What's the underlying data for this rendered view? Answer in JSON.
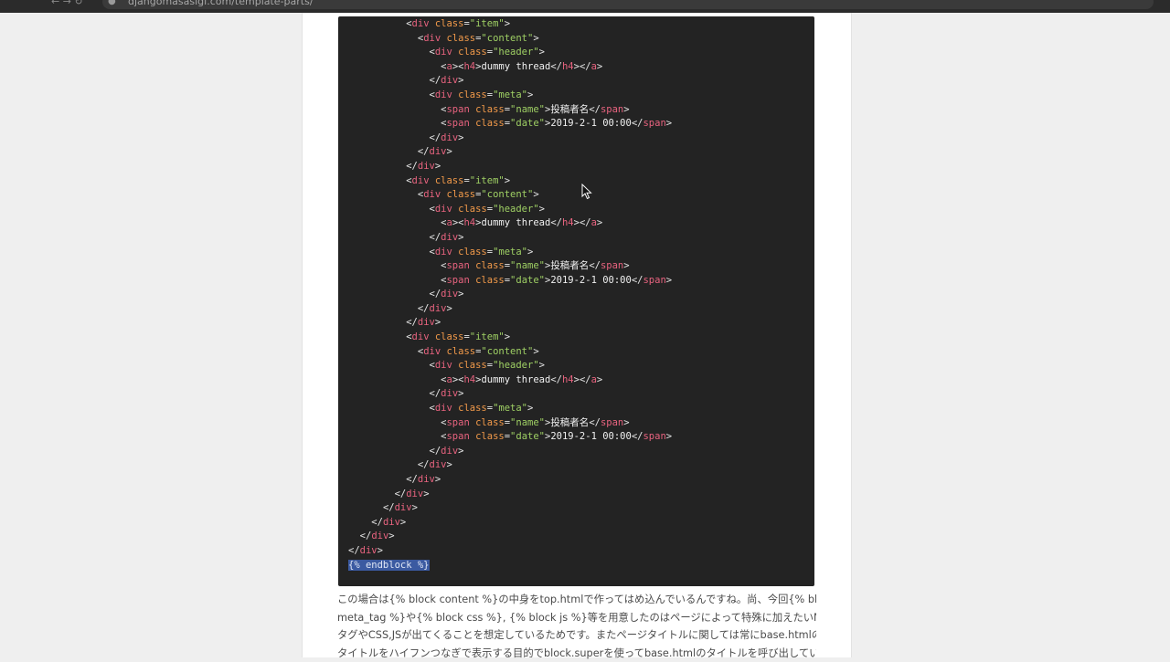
{
  "browser": {
    "url": "djangomasasigi.com/template-parts/",
    "nav_glyphs": "←  →  ↻"
  },
  "code": {
    "highlighted_text": "{% endblock %}",
    "lines": [
      {
        "indent": 5,
        "tokens": [
          [
            "p",
            "<"
          ],
          [
            "t",
            "div"
          ],
          [
            "p",
            " "
          ],
          [
            "a",
            "class"
          ],
          [
            "p",
            "="
          ],
          [
            "s",
            "\"item\""
          ],
          [
            "p",
            ">"
          ]
        ]
      },
      {
        "indent": 6,
        "tokens": [
          [
            "p",
            "<"
          ],
          [
            "t",
            "div"
          ],
          [
            "p",
            " "
          ],
          [
            "a",
            "class"
          ],
          [
            "p",
            "="
          ],
          [
            "s",
            "\"content\""
          ],
          [
            "p",
            ">"
          ]
        ]
      },
      {
        "indent": 7,
        "tokens": [
          [
            "p",
            "<"
          ],
          [
            "t",
            "div"
          ],
          [
            "p",
            " "
          ],
          [
            "a",
            "class"
          ],
          [
            "p",
            "="
          ],
          [
            "s",
            "\"header\""
          ],
          [
            "p",
            ">"
          ]
        ]
      },
      {
        "indent": 8,
        "tokens": [
          [
            "p",
            "<"
          ],
          [
            "t",
            "a"
          ],
          [
            "p",
            "><"
          ],
          [
            "t",
            "h4"
          ],
          [
            "p",
            ">"
          ],
          [
            "x",
            "dummy thread"
          ],
          [
            "p",
            "</"
          ],
          [
            "t",
            "h4"
          ],
          [
            "p",
            "></"
          ],
          [
            "t",
            "a"
          ],
          [
            "p",
            ">"
          ]
        ]
      },
      {
        "indent": 7,
        "tokens": [
          [
            "p",
            "</"
          ],
          [
            "t",
            "div"
          ],
          [
            "p",
            ">"
          ]
        ]
      },
      {
        "indent": 7,
        "tokens": [
          [
            "p",
            "<"
          ],
          [
            "t",
            "div"
          ],
          [
            "p",
            " "
          ],
          [
            "a",
            "class"
          ],
          [
            "p",
            "="
          ],
          [
            "s",
            "\"meta\""
          ],
          [
            "p",
            ">"
          ]
        ]
      },
      {
        "indent": 8,
        "tokens": [
          [
            "p",
            "<"
          ],
          [
            "t",
            "span"
          ],
          [
            "p",
            " "
          ],
          [
            "a",
            "class"
          ],
          [
            "p",
            "="
          ],
          [
            "s",
            "\"name\""
          ],
          [
            "p",
            ">"
          ],
          [
            "x",
            "投稿者名"
          ],
          [
            "p",
            "</"
          ],
          [
            "t",
            "span"
          ],
          [
            "p",
            ">"
          ]
        ]
      },
      {
        "indent": 8,
        "tokens": [
          [
            "p",
            "<"
          ],
          [
            "t",
            "span"
          ],
          [
            "p",
            " "
          ],
          [
            "a",
            "class"
          ],
          [
            "p",
            "="
          ],
          [
            "s",
            "\"date\""
          ],
          [
            "p",
            ">"
          ],
          [
            "x",
            "2019-2-1 00:00"
          ],
          [
            "p",
            "</"
          ],
          [
            "t",
            "span"
          ],
          [
            "p",
            ">"
          ]
        ]
      },
      {
        "indent": 7,
        "tokens": [
          [
            "p",
            "</"
          ],
          [
            "t",
            "div"
          ],
          [
            "p",
            ">"
          ]
        ]
      },
      {
        "indent": 6,
        "tokens": [
          [
            "p",
            "</"
          ],
          [
            "t",
            "div"
          ],
          [
            "p",
            ">"
          ]
        ]
      },
      {
        "indent": 5,
        "tokens": [
          [
            "p",
            "</"
          ],
          [
            "t",
            "div"
          ],
          [
            "p",
            ">"
          ]
        ]
      },
      {
        "indent": 5,
        "tokens": [
          [
            "p",
            "<"
          ],
          [
            "t",
            "div"
          ],
          [
            "p",
            " "
          ],
          [
            "a",
            "class"
          ],
          [
            "p",
            "="
          ],
          [
            "s",
            "\"item\""
          ],
          [
            "p",
            ">"
          ]
        ]
      },
      {
        "indent": 6,
        "tokens": [
          [
            "p",
            "<"
          ],
          [
            "t",
            "div"
          ],
          [
            "p",
            " "
          ],
          [
            "a",
            "class"
          ],
          [
            "p",
            "="
          ],
          [
            "s",
            "\"content\""
          ],
          [
            "p",
            ">"
          ]
        ]
      },
      {
        "indent": 7,
        "tokens": [
          [
            "p",
            "<"
          ],
          [
            "t",
            "div"
          ],
          [
            "p",
            " "
          ],
          [
            "a",
            "class"
          ],
          [
            "p",
            "="
          ],
          [
            "s",
            "\"header\""
          ],
          [
            "p",
            ">"
          ]
        ]
      },
      {
        "indent": 8,
        "tokens": [
          [
            "p",
            "<"
          ],
          [
            "t",
            "a"
          ],
          [
            "p",
            "><"
          ],
          [
            "t",
            "h4"
          ],
          [
            "p",
            ">"
          ],
          [
            "x",
            "dummy thread"
          ],
          [
            "p",
            "</"
          ],
          [
            "t",
            "h4"
          ],
          [
            "p",
            "></"
          ],
          [
            "t",
            "a"
          ],
          [
            "p",
            ">"
          ]
        ]
      },
      {
        "indent": 7,
        "tokens": [
          [
            "p",
            "</"
          ],
          [
            "t",
            "div"
          ],
          [
            "p",
            ">"
          ]
        ]
      },
      {
        "indent": 7,
        "tokens": [
          [
            "p",
            "<"
          ],
          [
            "t",
            "div"
          ],
          [
            "p",
            " "
          ],
          [
            "a",
            "class"
          ],
          [
            "p",
            "="
          ],
          [
            "s",
            "\"meta\""
          ],
          [
            "p",
            ">"
          ]
        ]
      },
      {
        "indent": 8,
        "tokens": [
          [
            "p",
            "<"
          ],
          [
            "t",
            "span"
          ],
          [
            "p",
            " "
          ],
          [
            "a",
            "class"
          ],
          [
            "p",
            "="
          ],
          [
            "s",
            "\"name\""
          ],
          [
            "p",
            ">"
          ],
          [
            "x",
            "投稿者名"
          ],
          [
            "p",
            "</"
          ],
          [
            "t",
            "span"
          ],
          [
            "p",
            ">"
          ]
        ]
      },
      {
        "indent": 8,
        "tokens": [
          [
            "p",
            "<"
          ],
          [
            "t",
            "span"
          ],
          [
            "p",
            " "
          ],
          [
            "a",
            "class"
          ],
          [
            "p",
            "="
          ],
          [
            "s",
            "\"date\""
          ],
          [
            "p",
            ">"
          ],
          [
            "x",
            "2019-2-1 00:00"
          ],
          [
            "p",
            "</"
          ],
          [
            "t",
            "span"
          ],
          [
            "p",
            ">"
          ]
        ]
      },
      {
        "indent": 7,
        "tokens": [
          [
            "p",
            "</"
          ],
          [
            "t",
            "div"
          ],
          [
            "p",
            ">"
          ]
        ]
      },
      {
        "indent": 6,
        "tokens": [
          [
            "p",
            "</"
          ],
          [
            "t",
            "div"
          ],
          [
            "p",
            ">"
          ]
        ]
      },
      {
        "indent": 5,
        "tokens": [
          [
            "p",
            "</"
          ],
          [
            "t",
            "div"
          ],
          [
            "p",
            ">"
          ]
        ]
      },
      {
        "indent": 5,
        "tokens": [
          [
            "p",
            "<"
          ],
          [
            "t",
            "div"
          ],
          [
            "p",
            " "
          ],
          [
            "a",
            "class"
          ],
          [
            "p",
            "="
          ],
          [
            "s",
            "\"item\""
          ],
          [
            "p",
            ">"
          ]
        ]
      },
      {
        "indent": 6,
        "tokens": [
          [
            "p",
            "<"
          ],
          [
            "t",
            "div"
          ],
          [
            "p",
            " "
          ],
          [
            "a",
            "class"
          ],
          [
            "p",
            "="
          ],
          [
            "s",
            "\"content\""
          ],
          [
            "p",
            ">"
          ]
        ]
      },
      {
        "indent": 7,
        "tokens": [
          [
            "p",
            "<"
          ],
          [
            "t",
            "div"
          ],
          [
            "p",
            " "
          ],
          [
            "a",
            "class"
          ],
          [
            "p",
            "="
          ],
          [
            "s",
            "\"header\""
          ],
          [
            "p",
            ">"
          ]
        ]
      },
      {
        "indent": 8,
        "tokens": [
          [
            "p",
            "<"
          ],
          [
            "t",
            "a"
          ],
          [
            "p",
            "><"
          ],
          [
            "t",
            "h4"
          ],
          [
            "p",
            ">"
          ],
          [
            "x",
            "dummy thread"
          ],
          [
            "p",
            "</"
          ],
          [
            "t",
            "h4"
          ],
          [
            "p",
            "></"
          ],
          [
            "t",
            "a"
          ],
          [
            "p",
            ">"
          ]
        ]
      },
      {
        "indent": 7,
        "tokens": [
          [
            "p",
            "</"
          ],
          [
            "t",
            "div"
          ],
          [
            "p",
            ">"
          ]
        ]
      },
      {
        "indent": 7,
        "tokens": [
          [
            "p",
            "<"
          ],
          [
            "t",
            "div"
          ],
          [
            "p",
            " "
          ],
          [
            "a",
            "class"
          ],
          [
            "p",
            "="
          ],
          [
            "s",
            "\"meta\""
          ],
          [
            "p",
            ">"
          ]
        ]
      },
      {
        "indent": 8,
        "tokens": [
          [
            "p",
            "<"
          ],
          [
            "t",
            "span"
          ],
          [
            "p",
            " "
          ],
          [
            "a",
            "class"
          ],
          [
            "p",
            "="
          ],
          [
            "s",
            "\"name\""
          ],
          [
            "p",
            ">"
          ],
          [
            "x",
            "投稿者名"
          ],
          [
            "p",
            "</"
          ],
          [
            "t",
            "span"
          ],
          [
            "p",
            ">"
          ]
        ]
      },
      {
        "indent": 8,
        "tokens": [
          [
            "p",
            "<"
          ],
          [
            "t",
            "span"
          ],
          [
            "p",
            " "
          ],
          [
            "a",
            "class"
          ],
          [
            "p",
            "="
          ],
          [
            "s",
            "\"date\""
          ],
          [
            "p",
            ">"
          ],
          [
            "x",
            "2019-2-1 00:00"
          ],
          [
            "p",
            "</"
          ],
          [
            "t",
            "span"
          ],
          [
            "p",
            ">"
          ]
        ]
      },
      {
        "indent": 7,
        "tokens": [
          [
            "p",
            "</"
          ],
          [
            "t",
            "div"
          ],
          [
            "p",
            ">"
          ]
        ]
      },
      {
        "indent": 6,
        "tokens": [
          [
            "p",
            "</"
          ],
          [
            "t",
            "div"
          ],
          [
            "p",
            ">"
          ]
        ]
      },
      {
        "indent": 5,
        "tokens": [
          [
            "p",
            "</"
          ],
          [
            "t",
            "div"
          ],
          [
            "p",
            ">"
          ]
        ]
      },
      {
        "indent": 4,
        "tokens": [
          [
            "p",
            "</"
          ],
          [
            "t",
            "div"
          ],
          [
            "p",
            ">"
          ]
        ]
      },
      {
        "indent": 3,
        "tokens": [
          [
            "p",
            "</"
          ],
          [
            "t",
            "div"
          ],
          [
            "p",
            ">"
          ]
        ]
      },
      {
        "indent": 2,
        "tokens": [
          [
            "p",
            "</"
          ],
          [
            "t",
            "div"
          ],
          [
            "p",
            ">"
          ]
        ]
      },
      {
        "indent": 1,
        "tokens": [
          [
            "p",
            "</"
          ],
          [
            "t",
            "div"
          ],
          [
            "p",
            ">"
          ]
        ]
      },
      {
        "indent": 0,
        "tokens": [
          [
            "p",
            "</"
          ],
          [
            "t",
            "div"
          ],
          [
            "p",
            ">"
          ]
        ]
      }
    ]
  },
  "prose": {
    "lines": [
      "この場合は{% block content %}の中身をtop.htmlで作ってはめ込んでいるんですね。尚、今回{% block",
      "meta_tag %}や{% block css %}, {% block js %}等を用意したのはページによって特殊に加えたいMETA",
      "タグやCSS,JSが出てくることを想定しているためです。またページタイトルに関しては常にbase.htmlの",
      "タイトルをハイフンつなぎで表示する目的でblock.superを使ってbase.htmlのタイトルを呼び出してい"
    ]
  },
  "colors": {
    "code_bg": "#232323",
    "tag": "#e8637f",
    "attr": "#f29a4a",
    "string": "#9fd064",
    "punct": "#e4e4e4",
    "selection": "#3b5aa1"
  },
  "icons": {
    "cursor": "mouse-pointer-icon",
    "site": "page-icon"
  }
}
